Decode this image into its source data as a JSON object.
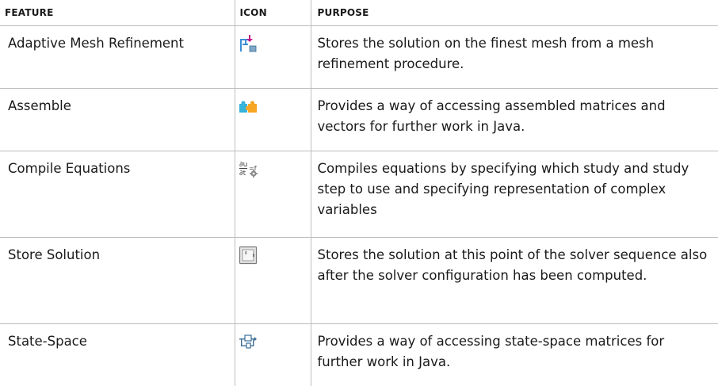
{
  "table": {
    "headers": [
      "FEATURE",
      "ICON",
      "PURPOSE"
    ],
    "rows": [
      {
        "feature": "Adaptive Mesh Refinement",
        "icon": "mesh-refinement-icon",
        "purpose": "Stores the solution on the finest mesh from a mesh refinement procedure."
      },
      {
        "feature": "Assemble",
        "icon": "assemble-puzzle-icon",
        "purpose": "Provides a way of accessing assembled matrices and vectors for further work in Java."
      },
      {
        "feature": "Compile Equations",
        "icon": "compile-equations-icon",
        "purpose": "Compiles equations by specifying which study and study step to use and specifying representation of complex variables"
      },
      {
        "feature": "Store Solution",
        "icon": "store-solution-icon",
        "purpose": "Stores the solution at this point of the solver sequence also after the solver configuration has been computed."
      },
      {
        "feature": "State-Space",
        "icon": "state-space-icon",
        "purpose": "Provides a way of accessing state-space matrices for further work in Java."
      }
    ]
  },
  "colors": {
    "rule": "#bdbdbd",
    "text": "#1a1a1a",
    "accent_blue": "#3a8fd6",
    "accent_orange": "#f5a623",
    "accent_magenta": "#c2188b"
  }
}
